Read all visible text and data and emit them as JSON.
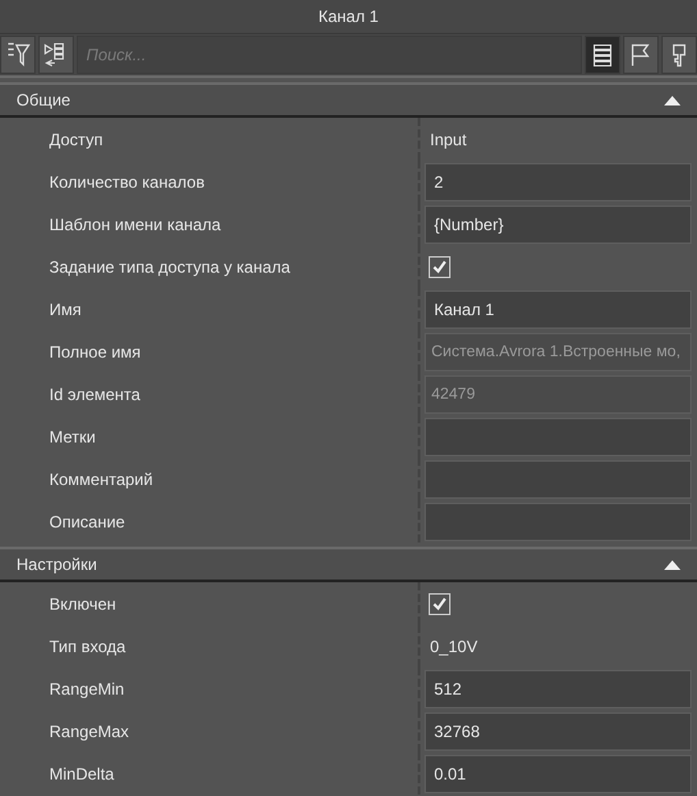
{
  "window": {
    "title": "Канал 1"
  },
  "toolbar": {
    "left_buttons": [
      {
        "kind": "sort-filter"
      },
      {
        "kind": "tree"
      }
    ],
    "search": {
      "placeholder": "Поиск..."
    },
    "view_buttons": [
      {
        "kind": "list",
        "selected": true
      },
      {
        "kind": "flag",
        "selected": false
      },
      {
        "kind": "key",
        "selected": false
      }
    ]
  },
  "sections": [
    {
      "title": "Общие",
      "expanded": true,
      "rows": [
        {
          "label": "Доступ",
          "kind": "text",
          "value": "Input"
        },
        {
          "label": "Количество каналов",
          "kind": "input",
          "value": "2"
        },
        {
          "label": "Шаблон имени канала",
          "kind": "input",
          "value": "{Number}"
        },
        {
          "label": "Задание типа доступа у канала",
          "kind": "check",
          "checked": true
        },
        {
          "label": "Имя",
          "kind": "input",
          "value": "Канал 1"
        },
        {
          "label": "Полное имя",
          "kind": "readonly",
          "value": "Система.Avrora 1.Встроенные мо,"
        },
        {
          "label": "Id элемента",
          "kind": "readonly",
          "value": "42479"
        },
        {
          "label": "Метки",
          "kind": "input"
        },
        {
          "label": "Комментарий",
          "kind": "input"
        },
        {
          "label": "Описание",
          "kind": "input"
        }
      ]
    },
    {
      "title": "Настройки",
      "expanded": true,
      "rows": [
        {
          "label": "Включен",
          "kind": "check",
          "checked": true
        },
        {
          "label": "Тип входа",
          "kind": "text",
          "value": "0_10V"
        },
        {
          "label": "RangeMin",
          "kind": "input",
          "value": "512"
        },
        {
          "label": "RangeMax",
          "kind": "input",
          "value": "32768"
        },
        {
          "label": "MinDelta",
          "kind": "input",
          "value": "0.01"
        }
      ]
    }
  ]
}
